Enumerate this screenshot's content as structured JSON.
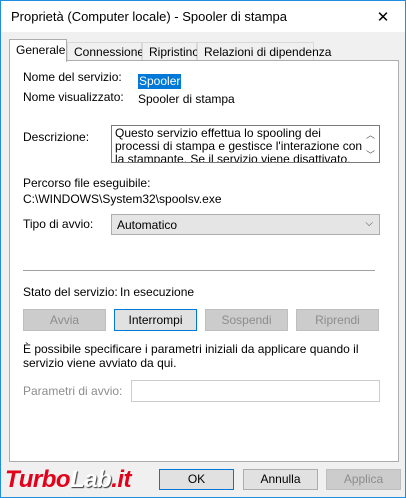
{
  "window": {
    "title": "Proprietà (Computer locale) - Spooler di stampa",
    "close_glyph": "✕"
  },
  "tabs": [
    {
      "label": "Generale"
    },
    {
      "label": "Connessione"
    },
    {
      "label": "Ripristino"
    },
    {
      "label": "Relazioni di dipendenza"
    }
  ],
  "general": {
    "service_name_label": "Nome del servizio:",
    "service_name_value": "Spooler",
    "display_name_label": "Nome visualizzato:",
    "display_name_value": "Spooler di stampa",
    "description_label": "Descrizione:",
    "description_value": "Questo servizio effettua lo spooling dei processi di stampa e gestisce l'interazione con la stampante. Se il servizio viene disattivato, non sarà più possibile",
    "exe_path_label": "Percorso file eseguibile:",
    "exe_path_value": "C:\\WINDOWS\\System32\\spoolsv.exe",
    "startup_type_label": "Tipo di avvio:",
    "startup_type_value": "Automatico",
    "status_label": "Stato del servizio:",
    "status_value": "In esecuzione",
    "buttons": {
      "start": "Avvia",
      "stop": "Interrompi",
      "pause": "Sospendi",
      "resume": "Riprendi"
    },
    "hint": "È possibile specificare i parametri iniziali da applicare quando il servizio viene avviato da qui.",
    "params_label": "Parametri di avvio:",
    "params_value": ""
  },
  "footer": {
    "ok": "OK",
    "cancel": "Annulla",
    "apply": "Applica"
  },
  "watermark": {
    "part1": "Turbo",
    "part2": "Lab",
    "part3": ".it"
  },
  "colors": {
    "accent": "#0078d7",
    "border_blue": "#1f8ee0",
    "watermark_red": "#e2001a"
  }
}
